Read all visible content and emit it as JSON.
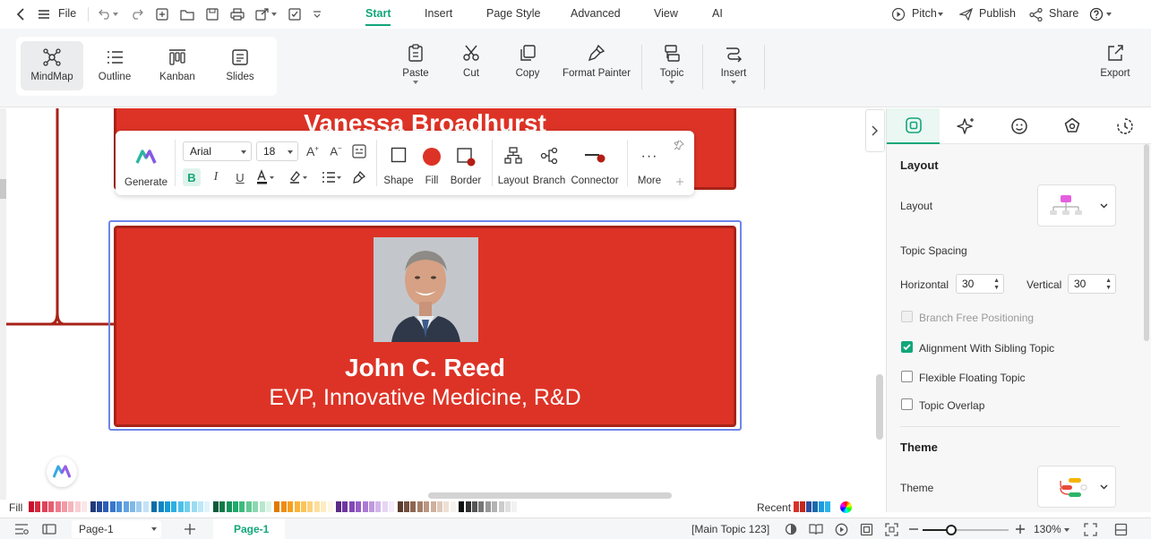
{
  "topbar": {
    "file_label": "File",
    "tabs": [
      {
        "label": "Start",
        "active": true
      },
      {
        "label": "Insert",
        "active": false
      },
      {
        "label": "Page Style",
        "active": false
      },
      {
        "label": "Advanced",
        "active": false
      },
      {
        "label": "View",
        "active": false
      },
      {
        "label": "AI",
        "active": false
      }
    ],
    "right_actions": {
      "pitch": "Pitch",
      "publish": "Publish",
      "share": "Share"
    },
    "accent_color": "#12a67a"
  },
  "ribbon": {
    "views": [
      {
        "label": "MindMap",
        "icon": "mindmap-icon",
        "active": true
      },
      {
        "label": "Outline",
        "icon": "outline-icon",
        "active": false
      },
      {
        "label": "Kanban",
        "icon": "kanban-icon",
        "active": false
      },
      {
        "label": "Slides",
        "icon": "slides-icon",
        "active": false
      }
    ],
    "buttons": {
      "paste": "Paste",
      "cut": "Cut",
      "copy": "Copy",
      "format_painter": "Format Painter",
      "topic": "Topic",
      "insert": "Insert",
      "export": "Export"
    }
  },
  "canvas": {
    "upper_card_title": "Vanessa Broadhurst",
    "selected_card": {
      "name": "John C. Reed",
      "title": "EVP, Innovative Medicine, R&D",
      "fill_color": "#dd3326",
      "border_color": "#a82318",
      "selection_color": "#6f86e8"
    }
  },
  "floating_toolbar": {
    "generate": "Generate",
    "font_family": "Arial",
    "font_size": "18",
    "shape": "Shape",
    "fill": "Fill",
    "border": "Border",
    "layout": "Layout",
    "branch": "Branch",
    "connector": "Connector",
    "more": "More"
  },
  "right_panel": {
    "tabs": [
      "layout-tab-icon",
      "ai-sparkle-icon",
      "emoji-icon",
      "theme-badge-icon",
      "clock-icon"
    ],
    "layout_section": {
      "heading": "Layout",
      "layout_label": "Layout",
      "topic_spacing_label": "Topic Spacing",
      "horizontal_label": "Horizontal",
      "horizontal_value": "30",
      "vertical_label": "Vertical",
      "vertical_value": "30",
      "options": [
        {
          "label": "Branch Free Positioning",
          "checked": false,
          "disabled": true
        },
        {
          "label": "Alignment With Sibling Topic",
          "checked": true,
          "disabled": false
        },
        {
          "label": "Flexible Floating Topic",
          "checked": false,
          "disabled": false
        },
        {
          "label": "Topic Overlap",
          "checked": false,
          "disabled": false
        }
      ]
    },
    "theme_section": {
      "heading": "Theme",
      "theme_label": "Theme"
    }
  },
  "colorbar": {
    "fill_label": "Fill",
    "recent_label": "Recent"
  },
  "statusbar": {
    "page_select": "Page-1",
    "page_tab": "Page-1",
    "selection_info": "[Main Topic 123]",
    "zoom": "130%"
  }
}
